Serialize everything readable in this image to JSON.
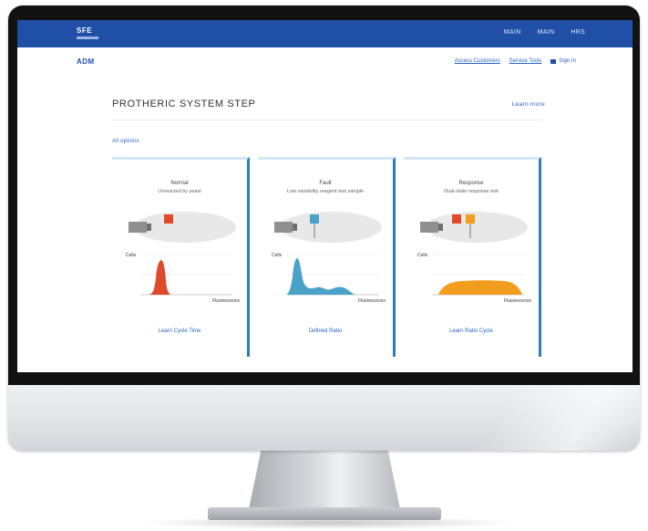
{
  "top_bar": {
    "brand": "SFE",
    "nav": [
      "MAIN",
      "MAIN",
      "HRS"
    ]
  },
  "sub_nav": {
    "logo": "ADM",
    "links": [
      "Access Customers",
      "Service Tools"
    ],
    "login": "Sign In"
  },
  "page": {
    "title": "PROTHERIC SYSTEM STEP",
    "header_link": "Learn more",
    "section_link": "All options"
  },
  "panels": [
    {
      "title": "Normal",
      "subtitle": "Unreacted by yeast",
      "link": "Learn Cycle Time",
      "ylabel": "Cells",
      "xlabel": "Fluorescence",
      "color": "#e0492a",
      "marker_colors": [
        "#e0492a"
      ],
      "distribution": "narrow-peak"
    },
    {
      "title": "Fault",
      "subtitle": "Low variability reagent test sample",
      "link": "Defined Ratio",
      "ylabel": "Cells",
      "xlabel": "Fluorescence",
      "color": "#4aa2c9",
      "marker_colors": [
        "#4aa2c9"
      ],
      "distribution": "skewed-peak"
    },
    {
      "title": "Response",
      "subtitle": "Dual-state response test",
      "link": "Learn Ratio Cycle",
      "ylabel": "Cells",
      "xlabel": "Fluorescence",
      "color": "#f39d1e",
      "marker_colors": [
        "#e0492a",
        "#f39d1e"
      ],
      "distribution": "plateau"
    }
  ]
}
